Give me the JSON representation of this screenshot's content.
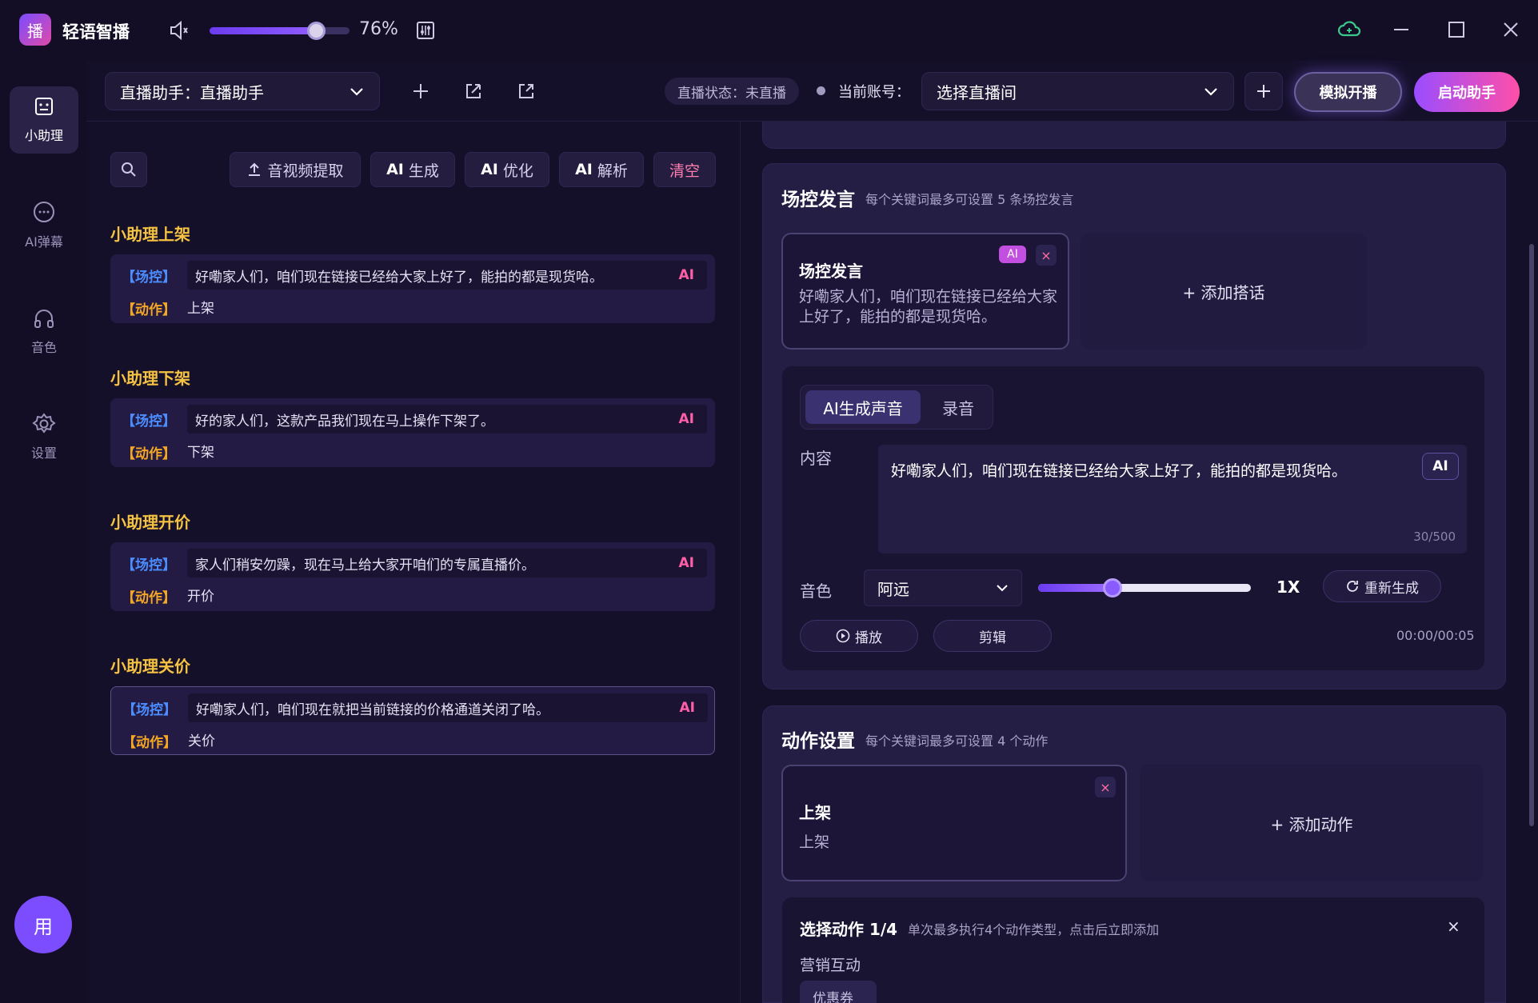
{
  "app": {
    "title": "轻语智播",
    "logo_glyph": "播",
    "volume_pct": 76,
    "volume_label": "76%"
  },
  "nav": [
    {
      "label": "小助理",
      "icon": "assistant-icon",
      "active": true
    },
    {
      "label": "AI弹幕",
      "icon": "chat-bubble-icon",
      "active": false
    },
    {
      "label": "音色",
      "icon": "headphones-icon",
      "active": false
    },
    {
      "label": "设置",
      "icon": "gear-icon",
      "active": false
    }
  ],
  "user": {
    "avatar_text": "用"
  },
  "toolbar": {
    "assistant_select": "直播助手：直播助手",
    "live_status": "直播状态：未直播",
    "account_label": "当前账号：",
    "account_select": "选择直播间",
    "simulate_label": "模拟开播",
    "start_label": "启动助手"
  },
  "left_tools": {
    "extract_label": "音视频提取",
    "ai_generate": {
      "prefix": "AI",
      "label": "生成"
    },
    "ai_optimize": {
      "prefix": "AI",
      "label": "优化"
    },
    "ai_parse": {
      "prefix": "AI",
      "label": "解析"
    },
    "clear_label": "清空"
  },
  "keyword_groups": [
    {
      "title": "小助理上架",
      "tag_control": "【场控】",
      "speech": "好嘞家人们，咱们现在链接已经给大家上好了，能拍的都是现货哈。",
      "ai": "AI",
      "tag_action": "【动作】",
      "action": "上架"
    },
    {
      "title": "小助理下架",
      "tag_control": "【场控】",
      "speech": "好的家人们，这款产品我们现在马上操作下架了。",
      "ai": "AI",
      "tag_action": "【动作】",
      "action": "下架"
    },
    {
      "title": "小助理开价",
      "tag_control": "【场控】",
      "speech": "家人们稍安勿躁，现在马上给大家开咱们的专属直播价。",
      "ai": "AI",
      "tag_action": "【动作】",
      "action": "开价"
    },
    {
      "title": "小助理关价",
      "tag_control": "【场控】",
      "speech": "好嘞家人们，咱们现在就把当前链接的价格通道关闭了哈。",
      "ai": "AI",
      "tag_action": "【动作】",
      "action": "关价"
    }
  ],
  "control_speech": {
    "title": "场控发言",
    "subtitle": "每个关键词最多可设置 5 条场控发言",
    "card_title": "场控发言",
    "card_ai_badge": "AI",
    "card_close": "×",
    "card_text": "好嘞家人们，咱们现在链接已经给大家上好了，能拍的都是现货哈。",
    "add_label": "+ 添加搭话",
    "seg_ai": "AI生成声音",
    "seg_record": "录音",
    "content_label": "内容",
    "content_text": "好嘞家人们，咱们现在链接已经给大家上好了，能拍的都是现货哈。",
    "content_ai": "AI",
    "counter": "30/500",
    "voice_label": "音色",
    "voice_value": "阿远",
    "speed_fraction": 0.35,
    "speed_label": "1X",
    "regen_label": "重新生成",
    "play_label": "播放",
    "edit_label": "剪辑",
    "time": "00:00/00:05"
  },
  "action_settings": {
    "title": "动作设置",
    "subtitle": "每个关键词最多可设置 4 个动作",
    "card_title": "上架",
    "card_sub": "上架",
    "card_close": "×",
    "add_label": "+ 添加动作",
    "select_title": "选择动作 1/4",
    "select_hint": "单次最多执行4个动作类型，点击后立即添加",
    "select_close": "×",
    "category": "营销互动",
    "chip_partial": "优惠券"
  },
  "colors": {
    "accent": "#7b4dff",
    "pink": "#ff4fa8",
    "gold": "#f5c242",
    "tag_blue": "#4c8dff"
  }
}
